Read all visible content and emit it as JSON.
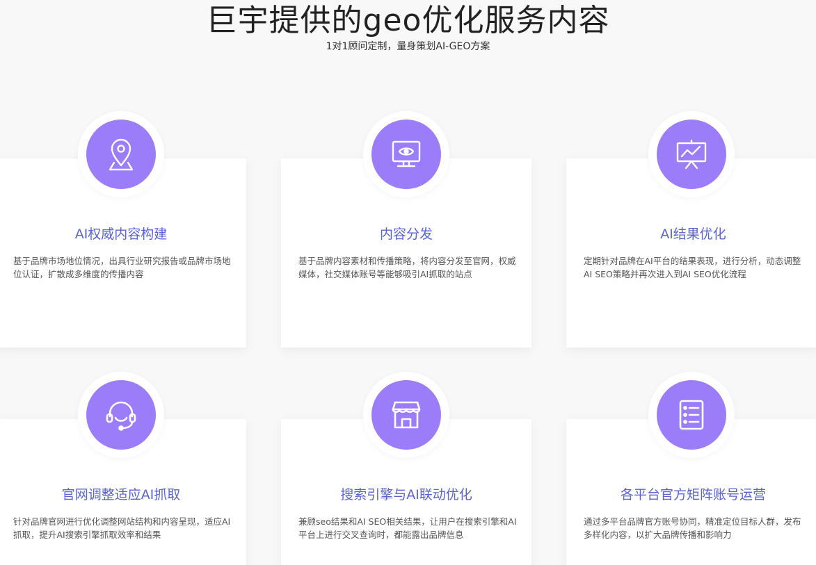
{
  "header": {
    "title": "巨宇提供的geo优化服务内容",
    "subtitle": "1对1顾问定制，量身策划AI-GEO方案"
  },
  "accent_color": "#9b7cf9",
  "title_color": "#5b63cf",
  "services": [
    {
      "icon": "location-pin-icon",
      "title": "AI权威内容构建",
      "desc": "基于品牌市场地位情况，出具行业研究报告或品牌市场地位认证，扩散成多维度的传播内容"
    },
    {
      "icon": "monitor-eye-icon",
      "title": "内容分发",
      "desc": "基于品牌内容素材和传播策略，将内容分发至官网，权威媒体，社交媒体账号等能够吸引AI抓取的站点"
    },
    {
      "icon": "presentation-chart-icon",
      "title": "AI结果优化",
      "desc": "定期针对品牌在AI平台的结果表现，进行分析，动态调整AI SEO策略并再次进入到AI SEO优化流程"
    },
    {
      "icon": "headset-icon",
      "title": "官网调整适应AI抓取",
      "desc": "针对品牌官网进行优化调整网站结构和内容呈现，适应AI抓取，提升AI搜索引擎抓取效率和结果"
    },
    {
      "icon": "storefront-icon",
      "title": "搜索引擎与AI联动优化",
      "desc": "兼顾seo结果和AI SEO相关结果，让用户在搜索引擎和AI平台上进行交叉查询时，都能露出品牌信息"
    },
    {
      "icon": "document-list-icon",
      "title": "各平台官方矩阵账号运营",
      "desc": "通过多平台品牌官方账号协同，精准定位目标人群，发布多样化内容，以扩大品牌传播和影响力"
    }
  ]
}
